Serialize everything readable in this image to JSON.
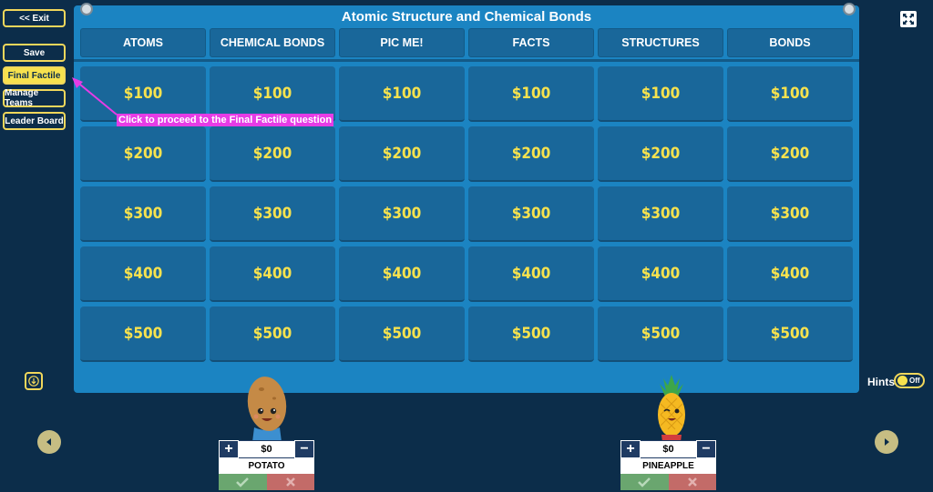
{
  "sidebar": {
    "exit_label": "<< Exit",
    "save_label": "Save",
    "final_factile_label": "Final Factile",
    "manage_teams_label": "Manage Teams",
    "leader_board_label": "Leader Board"
  },
  "board": {
    "title": "Atomic Structure and Chemical Bonds",
    "categories": [
      "ATOMS",
      "CHEMICAL BONDS",
      "PIC ME!",
      "FACTS",
      "STRUCTURES",
      "BONDS"
    ],
    "values": [
      "$100",
      "$200",
      "$300",
      "$400",
      "$500"
    ]
  },
  "tooltip": "Click to proceed to the Final Factile question",
  "hints": {
    "label": "Hints",
    "state": "Off"
  },
  "teams": [
    {
      "name": "POTATO",
      "score": "$0"
    },
    {
      "name": "PINEAPPLE",
      "score": "$0"
    }
  ],
  "colors": {
    "background": "#0c2d4a",
    "board": "#1b84c2",
    "tile": "#19679a",
    "accent": "#f7e24e",
    "tooltip": "#e63ce6"
  },
  "icons": [
    "download-icon",
    "fullscreen-icon",
    "previous-icon",
    "next-icon",
    "plus-icon",
    "minus-icon",
    "check-icon",
    "cross-icon",
    "potato-avatar",
    "pineapple-avatar"
  ]
}
